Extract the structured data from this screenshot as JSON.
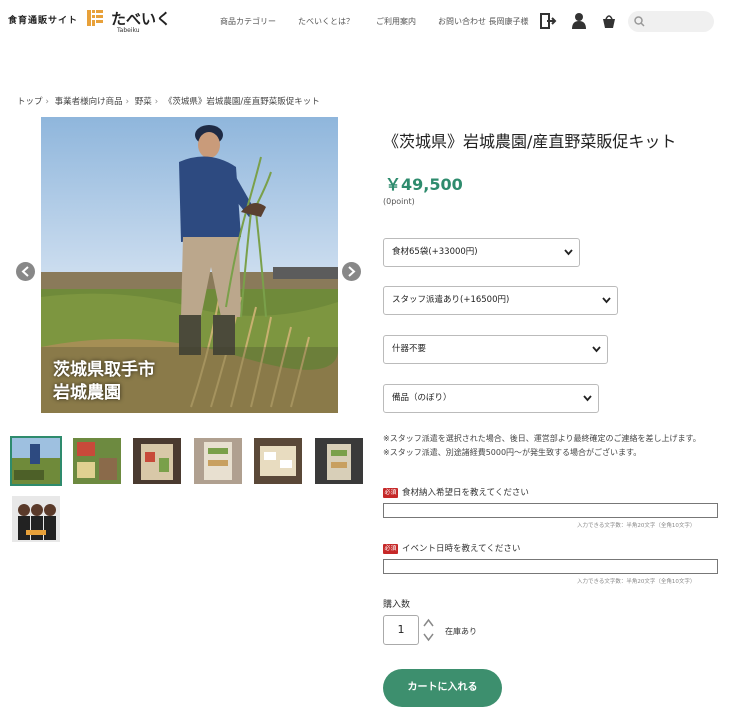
{
  "header": {
    "site_tag": "食育通販サイト",
    "logo_text": "たべいく",
    "logo_sub": "Tabeiku",
    "nav": [
      "商品カテゴリー",
      "たべいくとは？",
      "ご利用案内",
      "お問い合わせ 長岡康子様"
    ],
    "icons": [
      "logout-icon",
      "user-icon",
      "cart-icon",
      "search-icon"
    ]
  },
  "breadcrumb": [
    "トップ",
    "事業者様向け商品",
    "野菜",
    "《茨城県》岩城農園/産直野菜販促キット"
  ],
  "product": {
    "title": "《茨城県》岩城農園/産直野菜販促キット",
    "price": "￥49,500",
    "points": "(0point)",
    "photo_caption_line1": "茨城県取手市",
    "photo_caption_line2": "岩城農園",
    "thumbnail_count": 7
  },
  "options": [
    {
      "name": "ingredients",
      "selected": "食材65袋(+33000円)"
    },
    {
      "name": "staff",
      "selected": "スタッフ派遣あり(+16500円)"
    },
    {
      "name": "utensils",
      "selected": "什器不要"
    },
    {
      "name": "supplies",
      "selected": "備品（のぼり）"
    }
  ],
  "notes": [
    "※スタッフ派遣を選択された場合、後日、運営部より最終確定のご連絡を差し上げます。",
    "※スタッフ派遣、別途諸経費5000円〜が発生致する場合がございます。"
  ],
  "fields": {
    "required_badge": "必須",
    "delivery_label": "食材納入希望日を教えてください",
    "delivery_hint": "入力できる文字数：半角20文字（全角10文字）",
    "event_label": "イベント日時を教えてください",
    "event_hint": "入力できる文字数：半角20文字（全角10文字）"
  },
  "purchase": {
    "qty_label": "購入数",
    "qty_value": "1",
    "stock": "在庫あり",
    "cart_button": "カートに入れる"
  },
  "colors": {
    "accent": "#3d8f6e",
    "price": "#2e8b6d",
    "required": "#c62828"
  }
}
